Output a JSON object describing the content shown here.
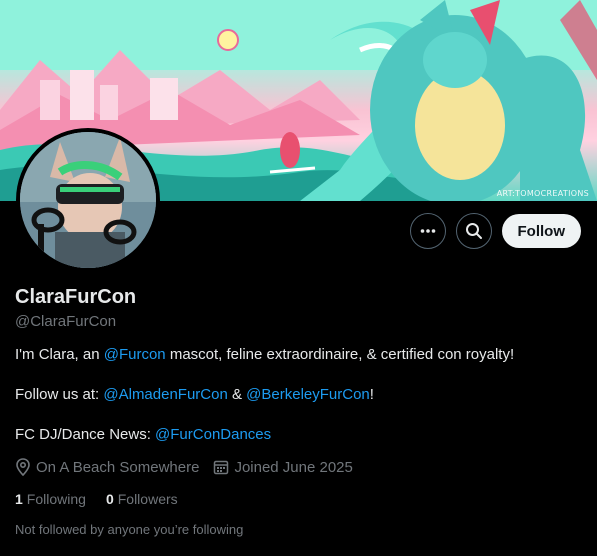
{
  "banner": {
    "credit": "ART:TOMOCREATIONS"
  },
  "profile": {
    "display_name": "ClaraFurCon",
    "handle": "@ClaraFurCon"
  },
  "actions": {
    "more_icon": "more-horizontal-icon",
    "search_icon": "search-icon",
    "follow_label": "Follow"
  },
  "bio": {
    "line1": {
      "prefix": "I'm Clara, an ",
      "mention": "@Furcon",
      "suffix": " mascot, feline extraordinaire, & certified con royalty!"
    },
    "line2": {
      "prefix": "Follow us at: ",
      "mention1": "@AlmadenFurCon",
      "middle": " & ",
      "mention2": "@BerkeleyFurCon",
      "suffix": "!"
    },
    "line3": {
      "prefix": "FC DJ/Dance News: ",
      "mention": "@FurConDances"
    }
  },
  "meta": {
    "location": "On A Beach Somewhere",
    "joined": "Joined June 2025"
  },
  "stats": {
    "following_count": "1",
    "following_label": "Following",
    "followers_count": "0",
    "followers_label": "Followers"
  },
  "note": "Not followed by anyone you’re following",
  "colors": {
    "link": "#1d9bf0",
    "muted": "#71767b",
    "text": "#e7e9ea"
  }
}
